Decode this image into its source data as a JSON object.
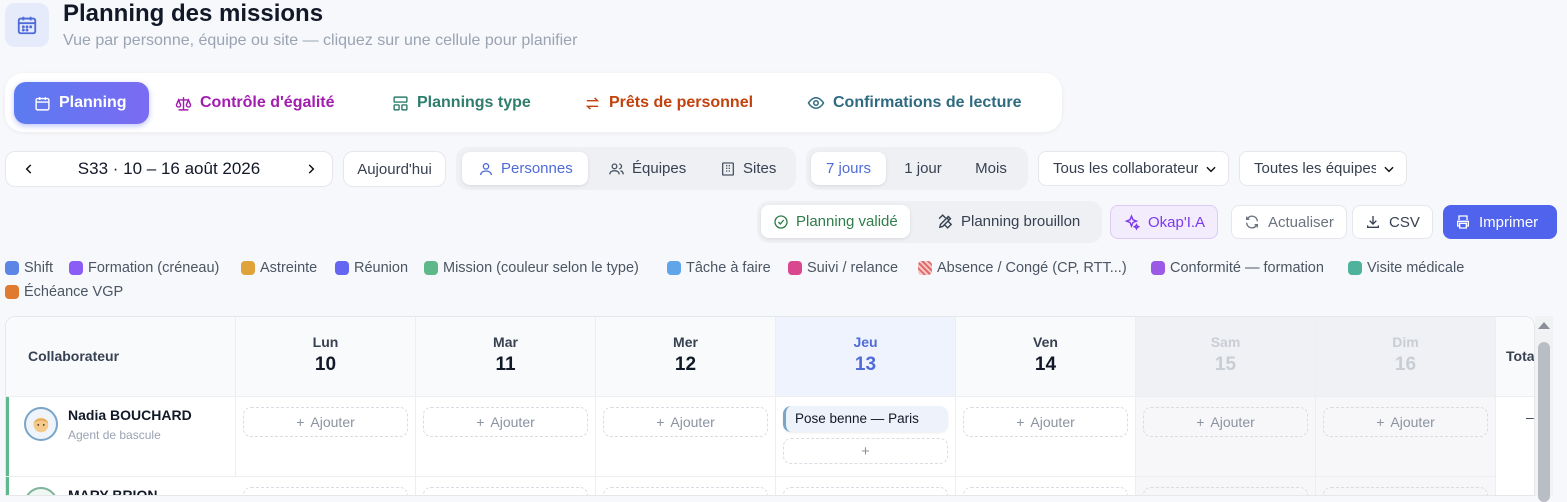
{
  "header": {
    "title": "Planning des missions",
    "subtitle": "Vue par personne, équipe ou site — cliquez sur une cellule pour planifier"
  },
  "tabs": [
    {
      "label": "Planning",
      "color": "#ffffff",
      "icon": "calendar-icon"
    },
    {
      "label": "Contrôle d'égalité",
      "color": "#a21caf",
      "icon": "scale-icon"
    },
    {
      "label": "Plannings type",
      "color": "#2f7d6d",
      "icon": "layout-icon"
    },
    {
      "label": "Prêts de personnel",
      "color": "#c2410c",
      "icon": "swap-icon"
    },
    {
      "label": "Confirmations de lecture",
      "color": "#2f6b80",
      "icon": "eye-icon"
    }
  ],
  "toolbar": {
    "week_label": "S33 · 10 – 16 août 2026",
    "today_label": "Aujourd'hui",
    "views": [
      "Personnes",
      "Équipes",
      "Sites"
    ],
    "ranges": [
      "7 jours",
      "1 jour",
      "Mois"
    ],
    "collaborator_filter": "Tous les collaborateurs",
    "team_filter": "Toutes les équipes",
    "planning_validated": "Planning validé",
    "planning_draft": "Planning brouillon",
    "ai_label": "Okap'I.A",
    "refresh_label": "Actualiser",
    "csv_label": "CSV",
    "print_label": "Imprimer"
  },
  "legend": [
    {
      "label": "Shift",
      "color": "#5b86e5"
    },
    {
      "label": "Formation (créneau)",
      "color": "#8b5cf6"
    },
    {
      "label": "Astreinte",
      "color": "#e0a23a"
    },
    {
      "label": "Réunion",
      "color": "#6366f1"
    },
    {
      "label": "Mission (couleur selon le type)",
      "color": "#5fb88a"
    },
    {
      "label": "Tâche à faire",
      "color": "#5fa5e8"
    },
    {
      "label": "Suivi / relance",
      "color": "#d9488f"
    },
    {
      "label": "Absence / Congé (CP, RTT...)",
      "color": "#e06b6b"
    },
    {
      "label": "Conformité — formation",
      "color": "#9a5ae6"
    },
    {
      "label": "Visite médicale",
      "color": "#4fb29a"
    },
    {
      "label": "Échéance VGP",
      "color": "#e07a2e"
    }
  ],
  "grid": {
    "collaborator_header": "Collaborateur",
    "total_header": "Total",
    "days": [
      {
        "name": "Lun",
        "num": "10"
      },
      {
        "name": "Mar",
        "num": "11"
      },
      {
        "name": "Mer",
        "num": "12"
      },
      {
        "name": "Jeu",
        "num": "13"
      },
      {
        "name": "Ven",
        "num": "14"
      },
      {
        "name": "Sam",
        "num": "15"
      },
      {
        "name": "Dim",
        "num": "16"
      }
    ],
    "add_label": "Ajouter",
    "rows": [
      {
        "name": "Nadia BOUCHARD",
        "role": "Agent de bascule",
        "event": "Pose benne — Paris",
        "total": "–"
      },
      {
        "name": "MARY BRION",
        "role": "",
        "event": "",
        "total": ""
      }
    ]
  }
}
